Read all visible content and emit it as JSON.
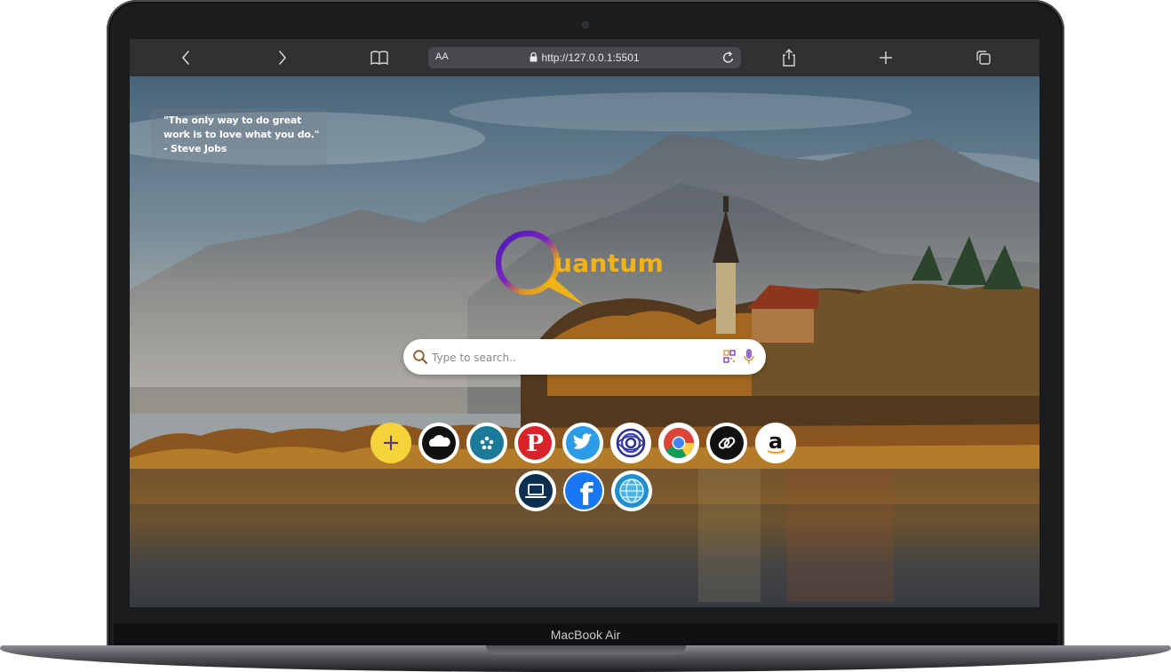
{
  "device": {
    "model_label": "MacBook Air"
  },
  "browser": {
    "text_size_label": "AA",
    "url": "http://127.0.0.1:5501",
    "icons": [
      "back-icon",
      "forward-icon",
      "bookmarks-icon",
      "lock-icon",
      "reload-icon",
      "share-icon",
      "new-tab-icon",
      "tabs-icon"
    ]
  },
  "page": {
    "quote": "\"The only way to do great work is to love what you do.\" - Steve Jobs",
    "logo_text": "uantum",
    "search": {
      "placeholder": "Type to search.."
    },
    "shortcuts": [
      {
        "name": "add-shortcut",
        "glyph": "+"
      },
      {
        "name": "cloud-shortcut",
        "glyph": ""
      },
      {
        "name": "flower-app-shortcut",
        "glyph": ""
      },
      {
        "name": "pinterest-shortcut",
        "glyph": "P"
      },
      {
        "name": "twitter-shortcut",
        "glyph": ""
      },
      {
        "name": "spiral-app-shortcut",
        "glyph": ""
      },
      {
        "name": "chrome-shortcut",
        "glyph": ""
      },
      {
        "name": "link-shortcut",
        "glyph": ""
      },
      {
        "name": "amazon-shortcut",
        "glyph": "a"
      },
      {
        "name": "laptop-shortcut",
        "glyph": ""
      },
      {
        "name": "facebook-shortcut",
        "glyph": "f"
      },
      {
        "name": "globe-shortcut",
        "glyph": ""
      }
    ]
  },
  "colors": {
    "accent_yellow": "#f2b318",
    "logo_purple": "#5b1fb8",
    "add_button": "#f5d33a",
    "toolbar": "#2f3133"
  }
}
